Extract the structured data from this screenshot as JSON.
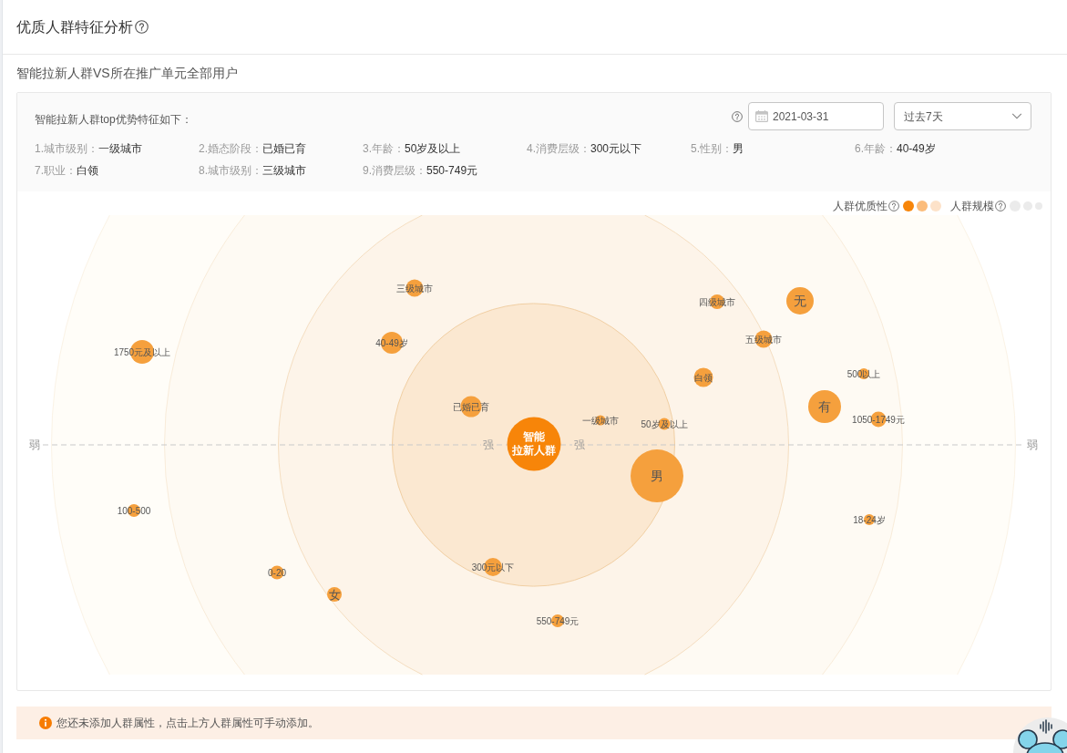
{
  "header": {
    "title": "优质人群特征分析"
  },
  "comparison": {
    "title": "智能拉新人群VS所在推广单元全部用户"
  },
  "summary": {
    "title": "智能拉新人群top优势特征如下：",
    "date_field": {
      "value": "2021-03-31"
    },
    "period_select": {
      "value": "过去7天"
    },
    "features": [
      {
        "label": "1.城市级别：",
        "value": "一级城市"
      },
      {
        "label": "2.婚态阶段：",
        "value": "已婚已育"
      },
      {
        "label": "3.年龄：",
        "value": "50岁及以上"
      },
      {
        "label": "4.消费层级：",
        "value": "300元以下"
      },
      {
        "label": "5.性别：",
        "value": "男"
      },
      {
        "label": "6.年龄：",
        "value": "40-49岁"
      },
      {
        "label": "7.职业：",
        "value": "白领"
      },
      {
        "label": "8.城市级别：",
        "value": "三级城市"
      },
      {
        "label": "9.消费层级：",
        "value": "550-749元"
      }
    ]
  },
  "legend": [
    {
      "kind": "quality",
      "label": "人群优质性"
    },
    {
      "kind": "scale",
      "label": "人群规模"
    }
  ],
  "chart": {
    "axis_labels": [
      "弱",
      "强",
      "强",
      "弱"
    ],
    "center": {
      "lines": [
        "智能",
        "拉新人群"
      ]
    },
    "bubbles": [
      "三级城市",
      "四级城市",
      "无",
      "1750元及以上",
      "40-49岁",
      "五级城市",
      "白领",
      "500以上",
      "已婚已育",
      "有",
      "一级城市",
      "50岁及以上",
      "1050-1749元",
      "男",
      "100-500",
      "18-24岁",
      "0-20",
      "300元以下",
      "女",
      "550-749元"
    ]
  },
  "notice": {
    "text": "您还未添加人群属性，点击上方人群属性可手动添加。"
  }
}
